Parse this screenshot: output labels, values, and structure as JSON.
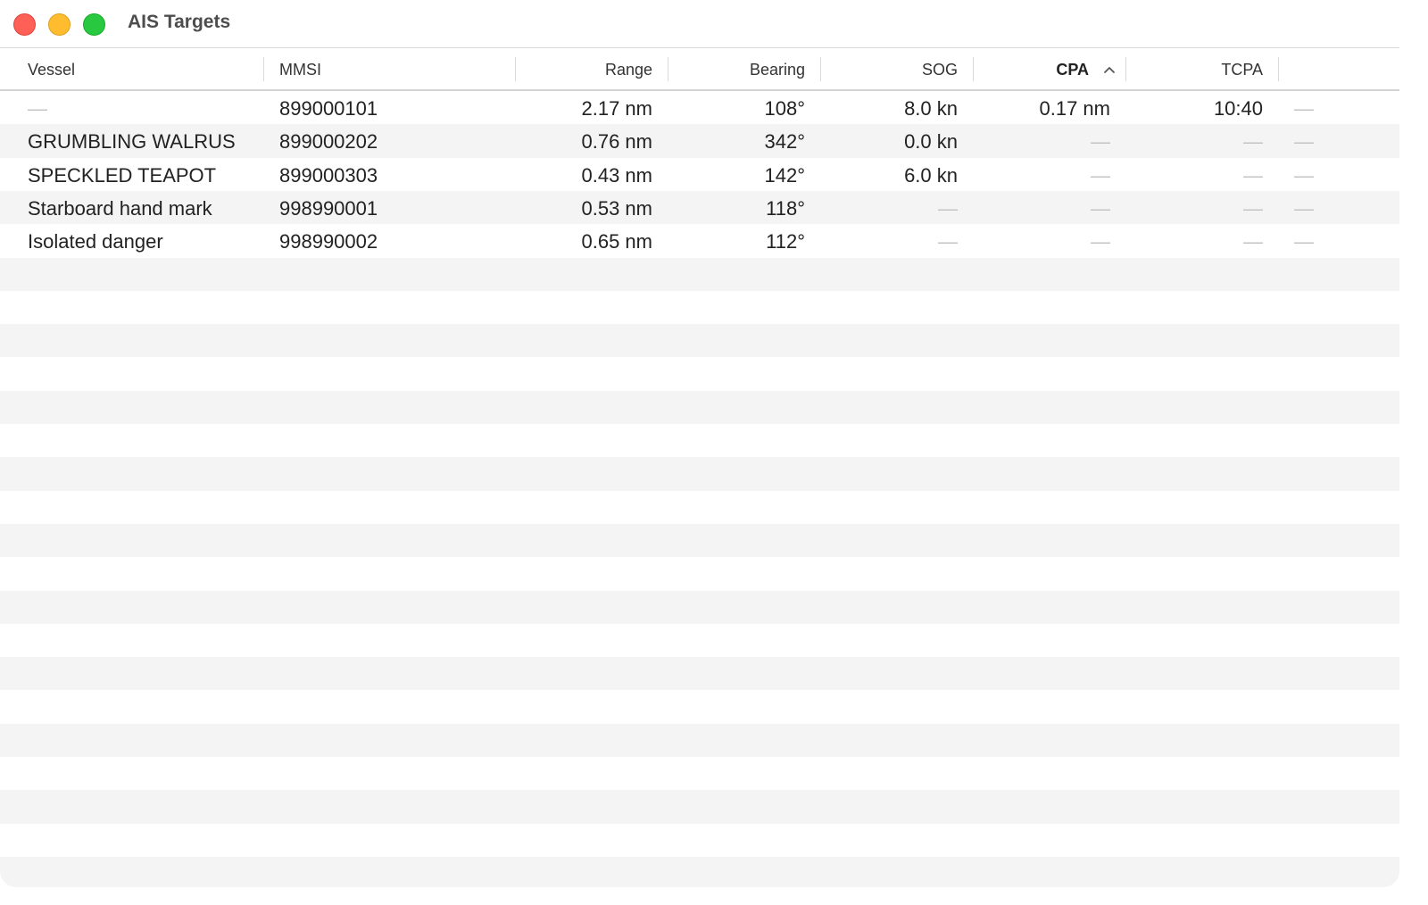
{
  "window": {
    "title": "AIS Targets"
  },
  "table": {
    "columns": [
      "Vessel",
      "MMSI",
      "Range",
      "Bearing",
      "SOG",
      "CPA",
      "TCPA"
    ],
    "sorted_column": "CPA",
    "sort_direction": "ascending",
    "rows": [
      {
        "vessel": "—",
        "mmsi": "899000101",
        "range": "2.17 nm",
        "bearing": "108°",
        "sog": "8.0 kn",
        "cpa": "0.17 nm",
        "tcpa": "10:40",
        "extra": "—"
      },
      {
        "vessel": "GRUMBLING WALRUS",
        "mmsi": "899000202",
        "range": "0.76 nm",
        "bearing": "342°",
        "sog": "0.0 kn",
        "cpa": "—",
        "tcpa": "—",
        "extra": "—"
      },
      {
        "vessel": "SPECKLED TEAPOT",
        "mmsi": "899000303",
        "range": "0.43 nm",
        "bearing": "142°",
        "sog": "6.0 kn",
        "cpa": "—",
        "tcpa": "—",
        "extra": "—"
      },
      {
        "vessel": "Starboard hand mark",
        "mmsi": "998990001",
        "range": "0.53 nm",
        "bearing": "118°",
        "sog": "—",
        "cpa": "—",
        "tcpa": "—",
        "extra": "—"
      },
      {
        "vessel": "Isolated danger",
        "mmsi": "998990002",
        "range": "0.65 nm",
        "bearing": "112°",
        "sog": "—",
        "cpa": "—",
        "tcpa": "—",
        "extra": "—"
      }
    ]
  },
  "colors": {
    "close": "#fe5f57",
    "minimize": "#febc2e",
    "maximize": "#28c840",
    "row_alt": "#f4f4f4",
    "placeholder_dash": "#c4c4c4"
  }
}
